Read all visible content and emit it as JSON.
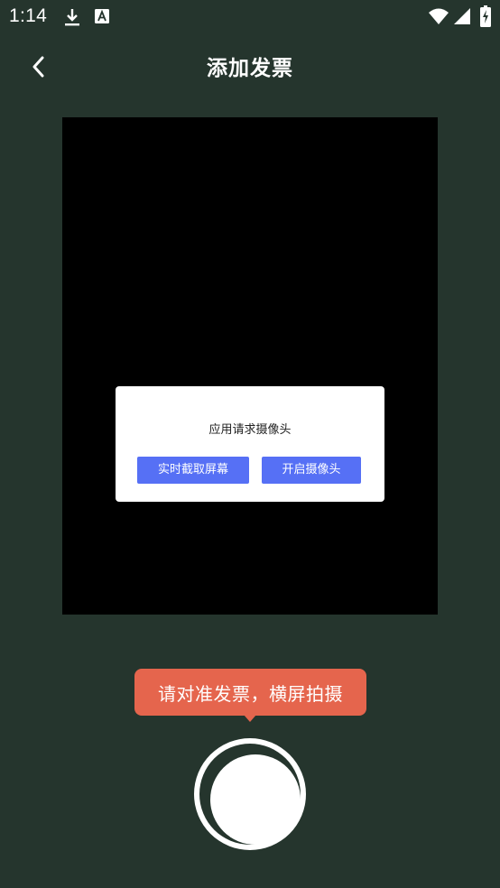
{
  "status_bar": {
    "time": "1:14",
    "icons": [
      "download-icon",
      "font-icon",
      "wifi-icon",
      "signal-icon",
      "battery-charging-icon"
    ]
  },
  "header": {
    "back_icon": "chevron-left-icon",
    "title": "添加发票"
  },
  "dialog": {
    "message": "应用请求摄像头",
    "buttons": {
      "screen_capture": "实时截取屏幕",
      "open_camera": "开启摄像头"
    },
    "button_color": "#5670f5"
  },
  "hint": {
    "text": "请对准发票，横屏拍摄",
    "color": "#e5654d"
  },
  "shutter": {
    "icon": "shutter-icon"
  },
  "colors": {
    "background": "#25352d",
    "preview": "#000000"
  }
}
